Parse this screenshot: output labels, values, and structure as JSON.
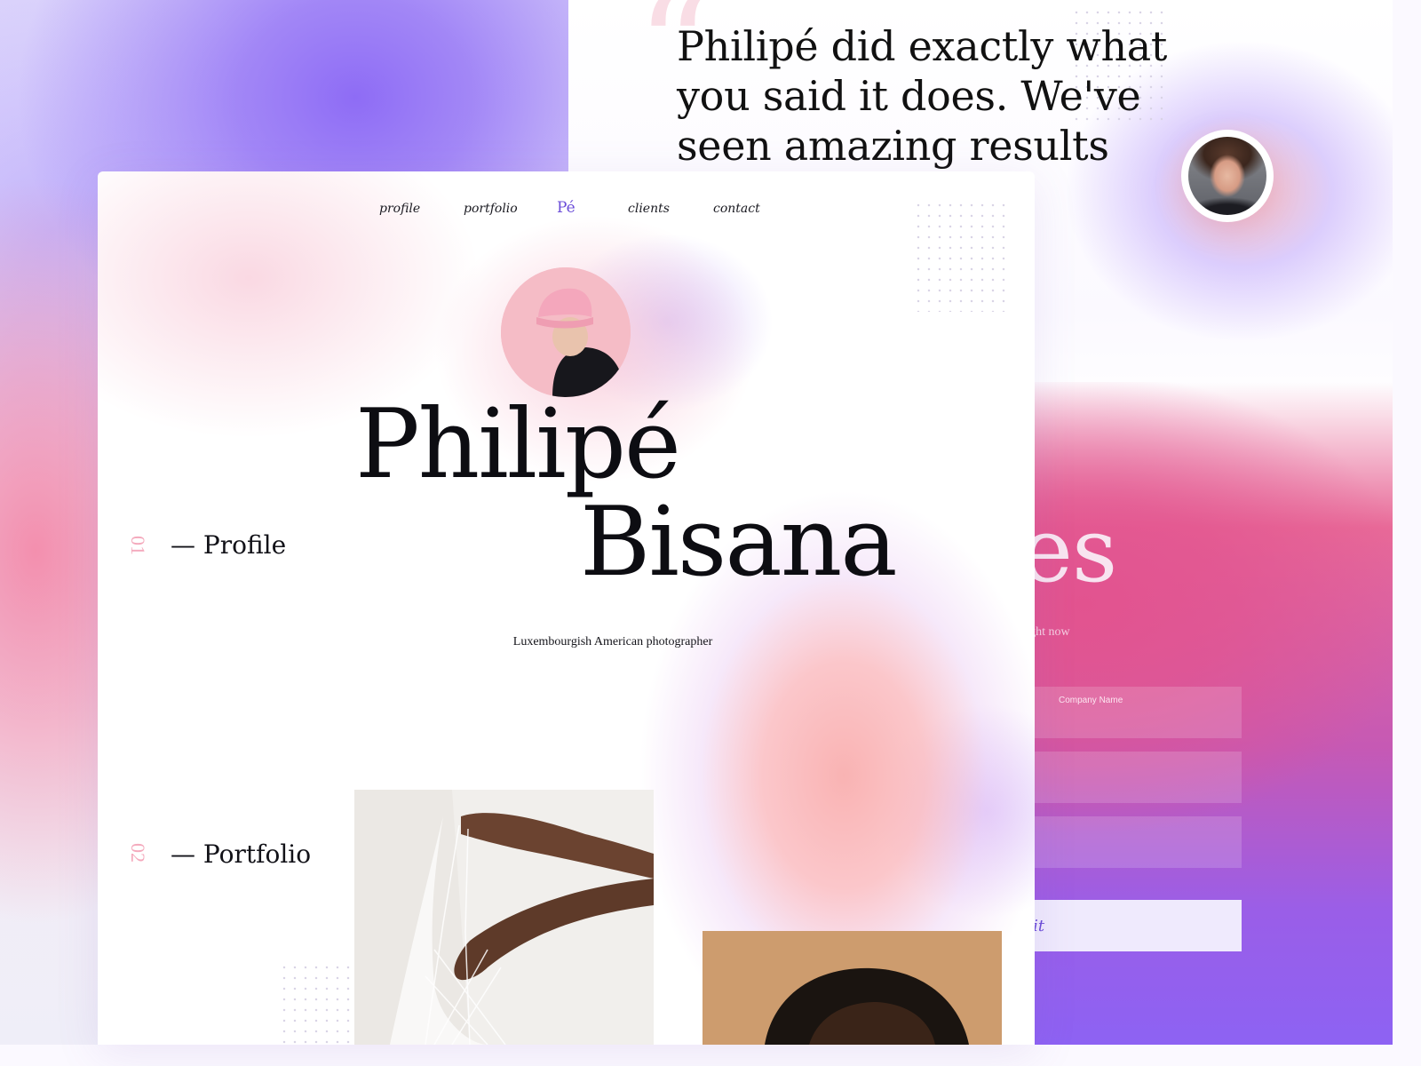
{
  "testimonial": {
    "quote": "Philipé did exactly what you said it does. We've seen amazing results"
  },
  "inquiry": {
    "title": "iries",
    "subtitle": "r project right now",
    "fields": [
      {
        "placeholder": "Company Name"
      },
      {
        "placeholder": ""
      },
      {
        "placeholder": ""
      }
    ],
    "submit_label": "mit"
  },
  "nav": {
    "items": [
      "profile",
      "portfolio",
      "clients",
      "contact"
    ],
    "logo": "Pé"
  },
  "hero": {
    "first_name": "Philipé",
    "last_name": "Bisana",
    "tagline": "Luxembourgish American photographer"
  },
  "sections": [
    {
      "number": "01",
      "label": "— Profile"
    },
    {
      "number": "02",
      "label": "— Portfolio"
    }
  ],
  "colors": {
    "accent": "#6a4cd8",
    "section_number": "#f4a9bc",
    "inquiry_pink": "#e2538f",
    "inquiry_purple": "#8d62f3"
  }
}
